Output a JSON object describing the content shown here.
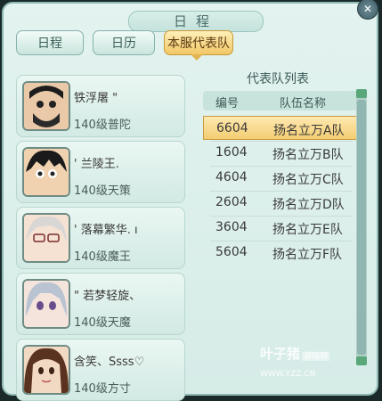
{
  "window": {
    "title": "日程",
    "close_label": "✕"
  },
  "tabs": [
    {
      "label": "日程"
    },
    {
      "label": "日历"
    },
    {
      "label": "本服代表队"
    }
  ],
  "members": [
    {
      "name": "铁浮屠 \"",
      "level": "140级普陀"
    },
    {
      "name": "' 兰陵王.",
      "level": "140级天策"
    },
    {
      "name": "' 落幕繁华. ı",
      "level": "140级魔王"
    },
    {
      "name": "\" 若梦轻旋、",
      "level": "140级天魔"
    },
    {
      "name": "含笑、Ssss♡",
      "level": "140级方寸"
    }
  ],
  "team_list": {
    "title": "代表队列表",
    "headers": {
      "code": "编号",
      "team": "队伍名称"
    },
    "rows": [
      {
        "code": "6604",
        "team": "扬名立万A队"
      },
      {
        "code": "1604",
        "team": "扬名立万B队"
      },
      {
        "code": "4604",
        "team": "扬名立万C队"
      },
      {
        "code": "2604",
        "team": "扬名立万D队"
      },
      {
        "code": "3604",
        "team": "扬名立万E队"
      },
      {
        "code": "5604",
        "team": "扬名立万F队"
      }
    ],
    "selected_index": 0
  },
  "watermark": {
    "name": "叶子猪",
    "tag": "游戏网",
    "url": "WWW.YZZ.CN"
  }
}
